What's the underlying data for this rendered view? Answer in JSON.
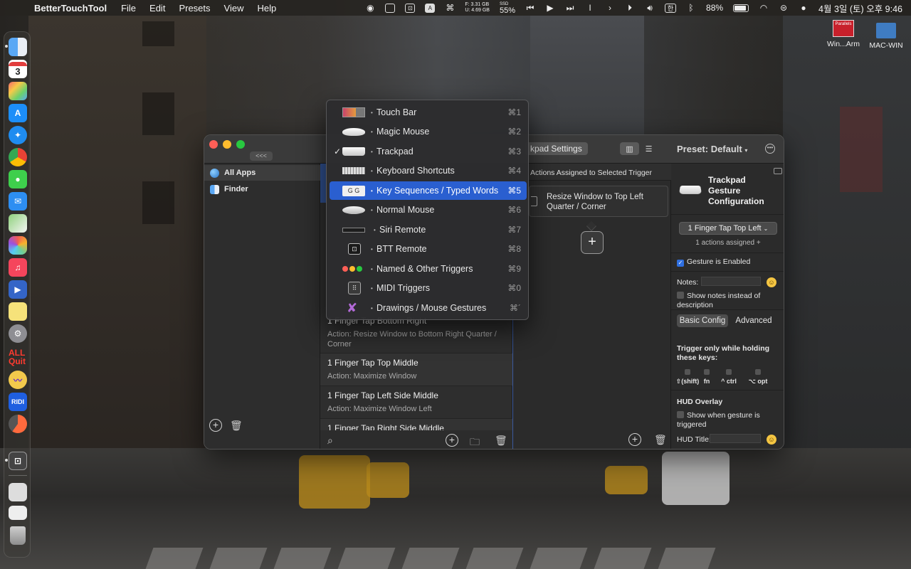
{
  "menubar": {
    "app_name": "BetterTouchTool",
    "menus": [
      "File",
      "Edit",
      "Presets",
      "View",
      "Help"
    ],
    "storage_f": "F: 3.31 GB",
    "storage_u": "U: 4.69 GB",
    "ssd_label": "SSD",
    "ssd_pct": "55%",
    "battery_pct": "88%",
    "input_lang": "한",
    "datetime": "4월 3일 (토) 오후 9:46"
  },
  "dock": {
    "calendar_day": "3",
    "allquit_label": "ALL Quit",
    "ridi_label": "RIDI"
  },
  "desktop": {
    "icon1_label": "Win...Arm",
    "icon1_badge": "Parallels",
    "icon2_label": "MAC-WIN"
  },
  "window": {
    "collapse_label": "<<<",
    "settings_tab": "kpad Settings",
    "preset_label": "Preset: Default",
    "apps": [
      {
        "label": "All Apps"
      },
      {
        "label": "Finder"
      }
    ],
    "triggers": [
      {
        "title": "1 Finger Tap Bottom Right",
        "action": "Action: Resize Window to Bottom Right Quarter / Corner"
      },
      {
        "title": "1 Finger Tap Top Middle",
        "action": "Action: Maximize Window"
      },
      {
        "title": "1 Finger Tap Left Side Middle",
        "action": "Action: Maximize Window Left"
      },
      {
        "title": "1 Finger Tap Right Side Middle",
        "action": ""
      }
    ],
    "actions_header": "Actions Assigned to Selected Trigger",
    "action_card": "Resize Window to Top Left Quarter / Corner",
    "add_symbol": "+"
  },
  "config": {
    "title": "Trackpad Gesture Configuration",
    "gesture_select": "1 Finger Tap Top Left",
    "actions_assigned": "1 actions assigned +",
    "gesture_enabled": "Gesture is Enabled",
    "notes_label": "Notes:",
    "show_notes": "Show notes instead of description",
    "tab_basic": "Basic Config",
    "tab_advanced": "Advanced",
    "trigger_keys_label": "Trigger only while holding these keys:",
    "keys": [
      "⇧(shift)",
      "fn",
      "^ ctrl",
      "⌥ opt"
    ],
    "hud_overlay": "HUD Overlay",
    "hud_show": "Show when gesture is triggered",
    "hud_title_label": "HUD Title:"
  },
  "dropdown": {
    "items": [
      {
        "label": "Touch Bar",
        "shortcut": "⌘1",
        "icon": "touchbar-icon",
        "checked": false,
        "highlighted": false
      },
      {
        "label": "Magic Mouse",
        "shortcut": "⌘2",
        "icon": "magic-mouse-icon",
        "checked": false,
        "highlighted": false
      },
      {
        "label": "Trackpad",
        "shortcut": "⌘3",
        "icon": "trackpad-icon",
        "checked": true,
        "highlighted": false
      },
      {
        "label": "Keyboard Shortcuts",
        "shortcut": "⌘4",
        "icon": "keyboard-icon",
        "checked": false,
        "highlighted": false
      },
      {
        "label": "Key Sequences / Typed Words",
        "shortcut": "⌘5",
        "icon": "key-sequence-icon",
        "checked": false,
        "highlighted": true
      },
      {
        "label": "Normal Mouse",
        "shortcut": "⌘6",
        "icon": "mouse-icon",
        "checked": false,
        "highlighted": false
      },
      {
        "label": "Siri Remote",
        "shortcut": "⌘7",
        "icon": "siri-remote-icon",
        "checked": false,
        "highlighted": false
      },
      {
        "label": "BTT Remote",
        "shortcut": "⌘8",
        "icon": "btt-remote-icon",
        "checked": false,
        "highlighted": false
      },
      {
        "label": "Named & Other Triggers",
        "shortcut": "⌘9",
        "icon": "traffic-lights-icon",
        "checked": false,
        "highlighted": false
      },
      {
        "label": "MIDI Triggers",
        "shortcut": "⌘0",
        "icon": "midi-icon",
        "checked": false,
        "highlighted": false
      },
      {
        "label": "Drawings / Mouse Gestures",
        "shortcut": "⌘´",
        "icon": "drawing-icon",
        "checked": false,
        "highlighted": false
      }
    ],
    "check_glyph": "✓",
    "bullet": "•"
  },
  "colors": {
    "accent": "#2a5fd0",
    "window_bg": "#2b2b2b",
    "menubar_bg": "#262421"
  }
}
